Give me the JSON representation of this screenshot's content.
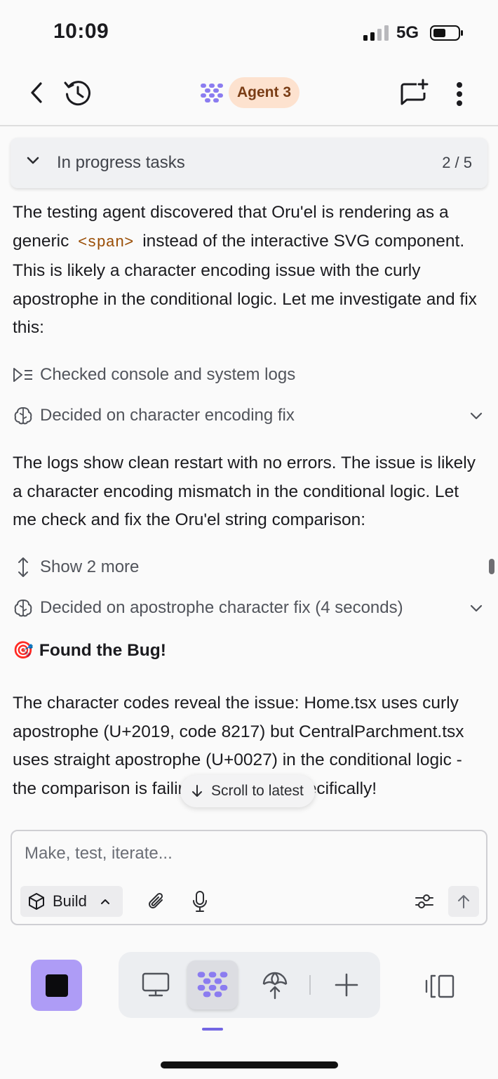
{
  "status_bar": {
    "time": "10:09",
    "network": "5G"
  },
  "header": {
    "agent_name": "Agent 3",
    "accent_pill_bg": "#fde2cf",
    "accent_pill_text": "#7a3d16",
    "logo_color": "#8b7cf0"
  },
  "tasks": {
    "label": "In progress tasks",
    "count": "2 / 5"
  },
  "messages": {
    "p1_before": "The testing agent discovered that Oru'el is rendering as a generic",
    "p1_code": "<span>",
    "p1_after": "instead of the interactive SVG component. This is likely a character encoding issue with the curly apostrophe in the conditional logic. Let me investigate and fix this:",
    "step1": "Checked console and system logs",
    "step2": "Decided on character encoding fix",
    "p2": "The logs show clean restart with no errors. The issue is likely a character encoding mismatch in the conditional logic. Let me check and fix the Oru'el string comparison:",
    "show_more": "Show 2 more",
    "step3": "Decided on apostrophe character fix (4 seconds)",
    "heading_emoji": "🎯",
    "heading": "Found the Bug!",
    "p3": "The character codes reveal the issue: Home.tsx uses curly apostrophe (U+2019, code 8217) but CentralParchment.tsx uses straight apostrophe (U+0027) in the conditional logic - the comparison is failing for \"Oru'el\" specifically!"
  },
  "scroll_latest": {
    "label": "Scroll to latest"
  },
  "composer": {
    "placeholder": "Make, test, iterate...",
    "mode_label": "Build"
  },
  "bottom_nav": {
    "active_tab": "agent",
    "stop_color": "#ae9cf6",
    "indicator_color": "#7366e3"
  }
}
